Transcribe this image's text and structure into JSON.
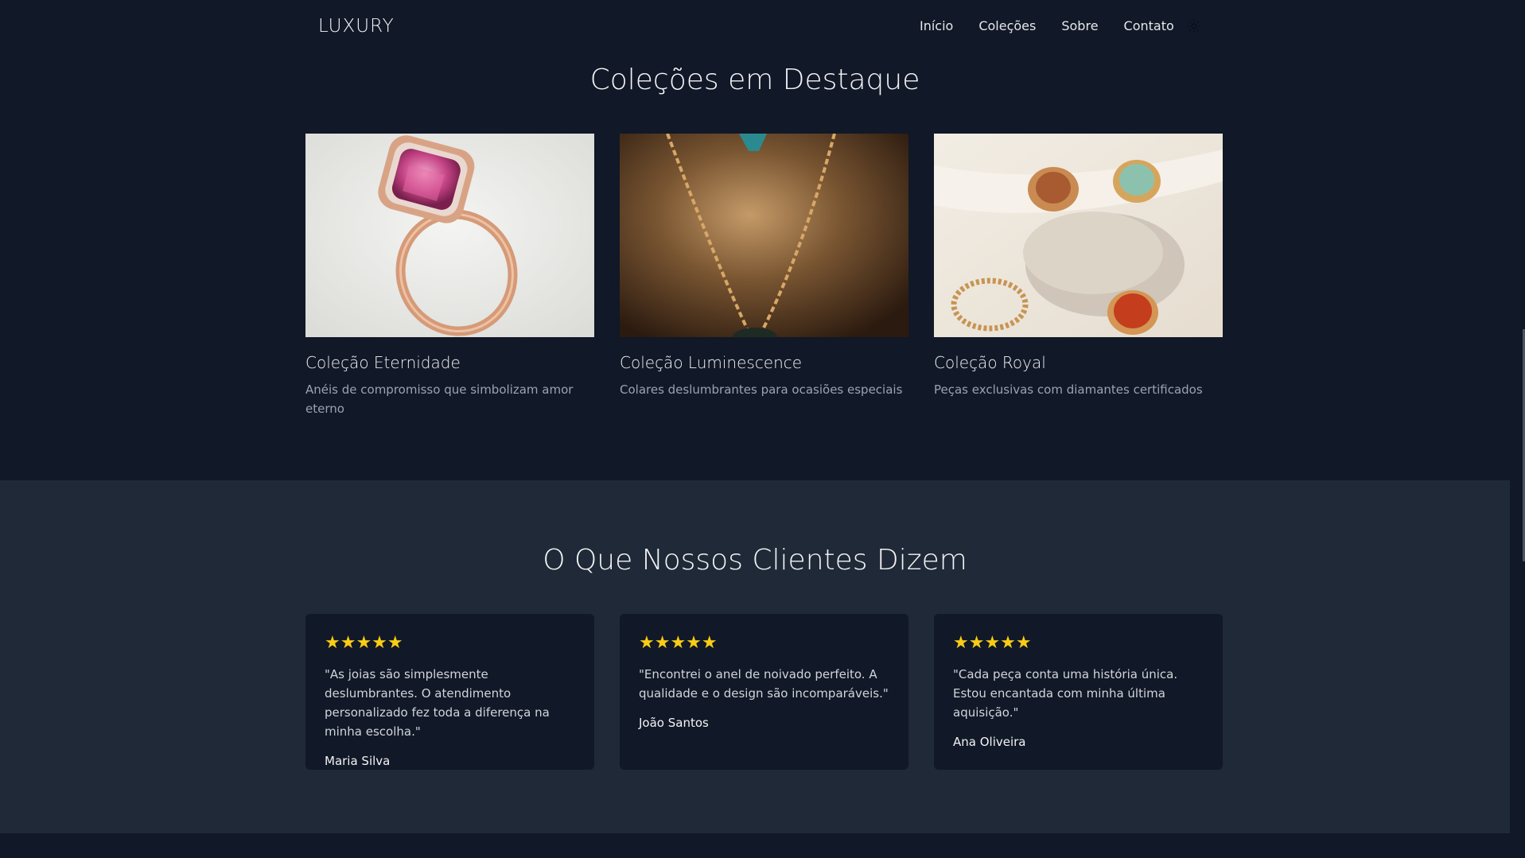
{
  "header": {
    "logo": "LUXURY",
    "nav": [
      "Início",
      "Coleções",
      "Sobre",
      "Contato"
    ],
    "theme_icon": "sun-icon"
  },
  "collections": {
    "title": "Coleções em Destaque",
    "items": [
      {
        "title": "Coleção Eternidade",
        "desc": "Anéis de compromisso que simbolizam amor eterno",
        "image": "rose-gold-pink-sapphire-ring"
      },
      {
        "title": "Coleção Luminescence",
        "desc": "Colares deslumbrantes para ocasiões especiais",
        "image": "gold-chain-necklace"
      },
      {
        "title": "Coleção Royal",
        "desc": "Peças exclusivas com diamantes certificados",
        "image": "gold-rings-on-stone"
      }
    ]
  },
  "testimonials": {
    "title": "O Que Nossos Clientes Dizem",
    "star_color": "#facc15",
    "items": [
      {
        "rating": 5,
        "stars": "★★★★★",
        "quote": "\"As joias são simplesmente deslumbrantes. O atendimento personalizado fez toda a diferença na minha escolha.\"",
        "author": "Maria Silva"
      },
      {
        "rating": 5,
        "stars": "★★★★★",
        "quote": "\"Encontrei o anel de noivado perfeito. A qualidade e o design são incomparáveis.\"",
        "author": "João Santos"
      },
      {
        "rating": 5,
        "stars": "★★★★★",
        "quote": "\"Cada peça conta uma história única. Estou encantada com minha última aquisição.\"",
        "author": "Ana Oliveira"
      }
    ]
  }
}
